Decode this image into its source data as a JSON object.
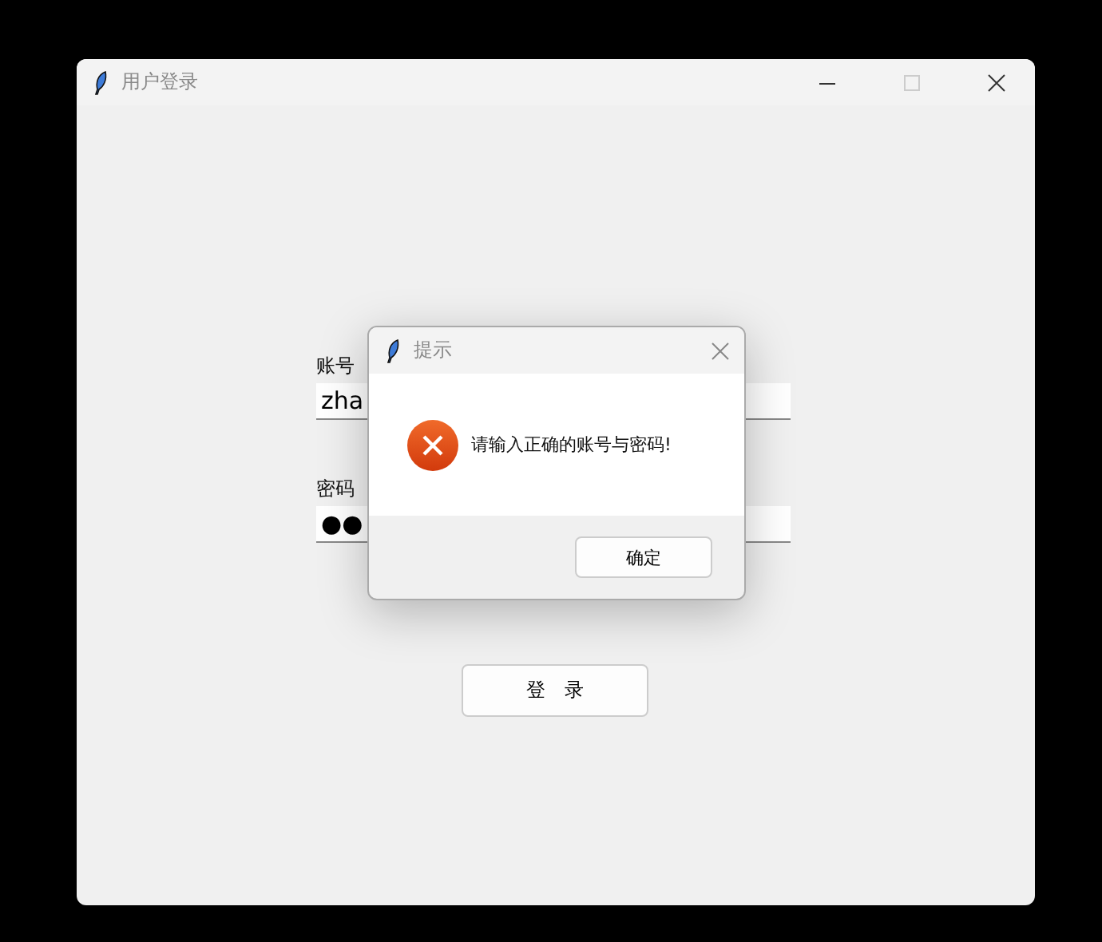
{
  "window": {
    "title": "用户登录"
  },
  "form": {
    "fields": [
      {
        "label": "账号",
        "value": "zha"
      },
      {
        "label": "密码",
        "value": "●●"
      }
    ],
    "submit": "登　录"
  },
  "dialog": {
    "title": "提示",
    "message": "请输入正确的账号与密码!",
    "button": "确定"
  }
}
